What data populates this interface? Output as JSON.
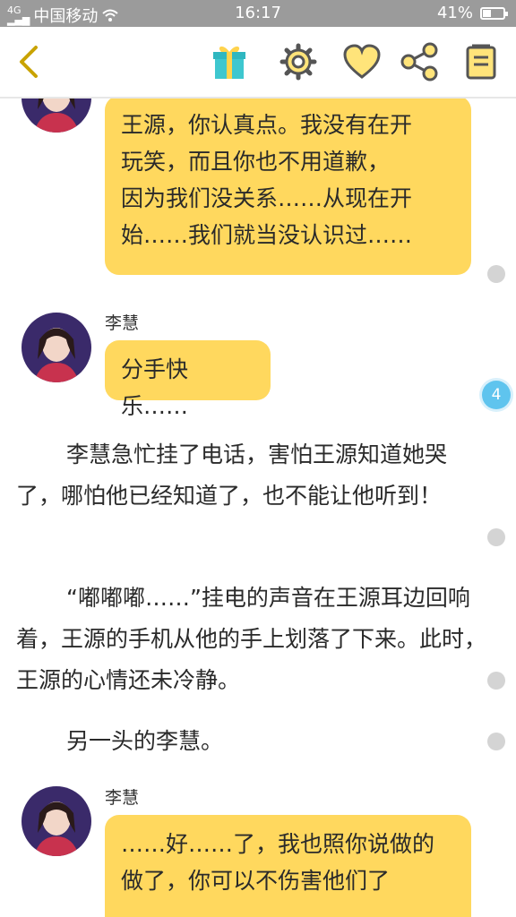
{
  "status_bar": {
    "carrier": "中国移动",
    "time": "16:17",
    "battery": "41%",
    "battery_level": 0.41
  },
  "toolbar": {
    "icons": [
      "back-arrow-icon",
      "gift-icon",
      "gear-icon",
      "heart-icon",
      "share-icon",
      "book-icon"
    ]
  },
  "colors": {
    "bubble": "#ffd85e",
    "accent_icon": "#c9a300",
    "badge": "#5fc4ee"
  },
  "chat": {
    "msg1": {
      "lines": [
        "王源，你认真点。我没有在开",
        "玩笑，而且你也不用道歉，",
        "因为我们没关系……从现在开",
        "始……我们就当没认识过……"
      ]
    },
    "msg2": {
      "sender": "李慧",
      "text": "分手快乐……",
      "comment_count": "4"
    },
    "para1": "李慧急忙挂了电话，害怕王源知道她哭了，哪怕他已经知道了，也不能让他听到！",
    "para2": "“嘟嘟嘟……”挂电的声音在王源耳边回响着，王源的手机从他的手上划落了下来。此时，王源的心情还未冷静。",
    "para3": "另一头的李慧。",
    "msg3": {
      "sender": "李慧",
      "lines": [
        "……好……了，我也照你说做的",
        "做了，你可以不伤害他们了"
      ]
    }
  }
}
